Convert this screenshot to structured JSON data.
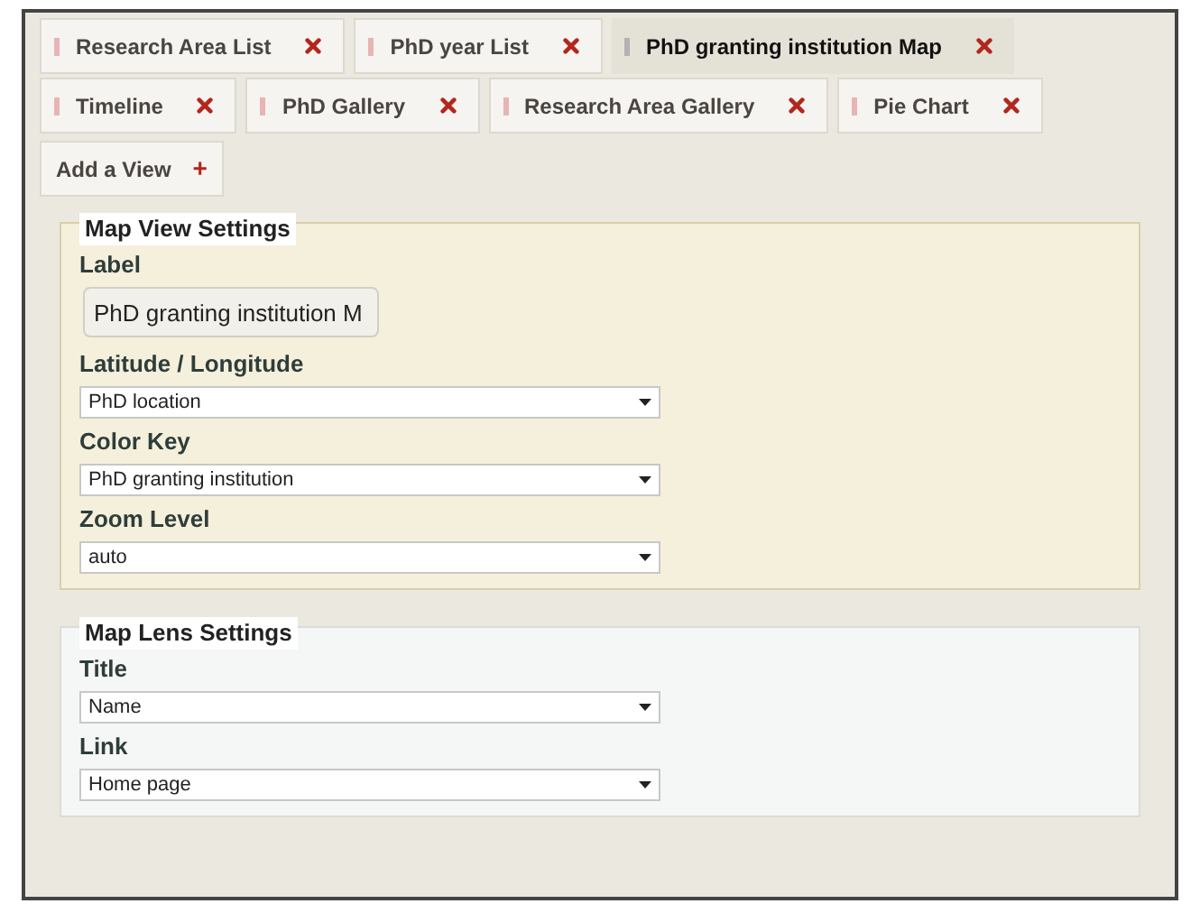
{
  "tabs": [
    {
      "label": "Research Area List",
      "selected": false
    },
    {
      "label": "PhD year List",
      "selected": false
    },
    {
      "label": "PhD granting institution Map",
      "selected": true
    },
    {
      "label": "Timeline",
      "selected": false
    },
    {
      "label": "PhD Gallery",
      "selected": false
    },
    {
      "label": "Research Area Gallery",
      "selected": false
    },
    {
      "label": "Pie Chart",
      "selected": false
    }
  ],
  "add_view": {
    "label": "Add a View",
    "symbol": "+"
  },
  "sections": [
    {
      "title": "Map View Settings",
      "kind": "view",
      "fields": [
        {
          "label": "Label",
          "kind": "text",
          "value": "PhD granting institution M"
        },
        {
          "label": "Latitude / Longitude",
          "kind": "select",
          "value": "PhD location"
        },
        {
          "label": "Color Key",
          "kind": "select",
          "value": "PhD granting institution"
        },
        {
          "label": "Zoom Level",
          "kind": "select",
          "value": "auto"
        }
      ]
    },
    {
      "title": "Map Lens Settings",
      "kind": "lens",
      "fields": [
        {
          "label": "Title",
          "kind": "select",
          "value": "Name"
        },
        {
          "label": "Link",
          "kind": "select",
          "value": "Home page"
        }
      ]
    }
  ]
}
